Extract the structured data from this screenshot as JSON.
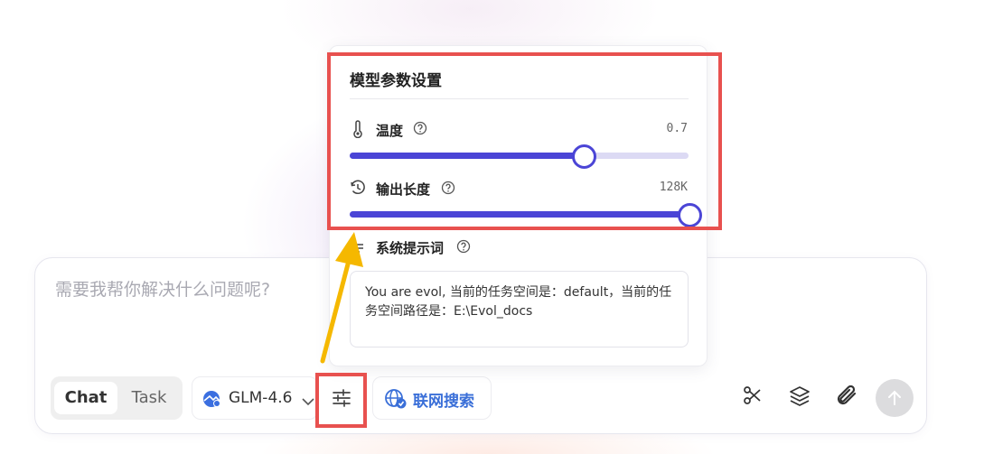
{
  "chat": {
    "placeholder": "需要我帮你解决什么问题呢?",
    "modes": [
      "Chat",
      "Task"
    ],
    "active_mode": "Chat",
    "model_name": "GLM-4.6",
    "web_search_label": "联网搜索",
    "send_disabled": true
  },
  "panel": {
    "title": "模型参数设置",
    "temperature": {
      "label": "温度",
      "value_text": "0.7",
      "fraction": 0.687
    },
    "output_length": {
      "label": "输出长度",
      "value_text": "128K",
      "fraction": 1.0
    },
    "system_prompt": {
      "label": "系统提示词",
      "text": "You are evol, 当前的任务空间是：default，当前的任务空间路径是：E:\\Evol_docs"
    }
  },
  "icons": {
    "model": "globe-agent-icon",
    "settings": "sliders-icon",
    "web_search": "globe-check-icon",
    "tools": [
      "scissors-icon",
      "layers-icon",
      "paperclip-icon"
    ],
    "send": "arrow-up-icon",
    "temperature": "thermometer-icon",
    "output_length": "history-icon",
    "help": "question-circle-icon"
  },
  "colors": {
    "accent": "#4b45d6",
    "track": "#dcdaf4",
    "link_blue": "#3a6fd8",
    "annotation_red": "#e8514f",
    "annotation_arrow": "#f5b800"
  }
}
